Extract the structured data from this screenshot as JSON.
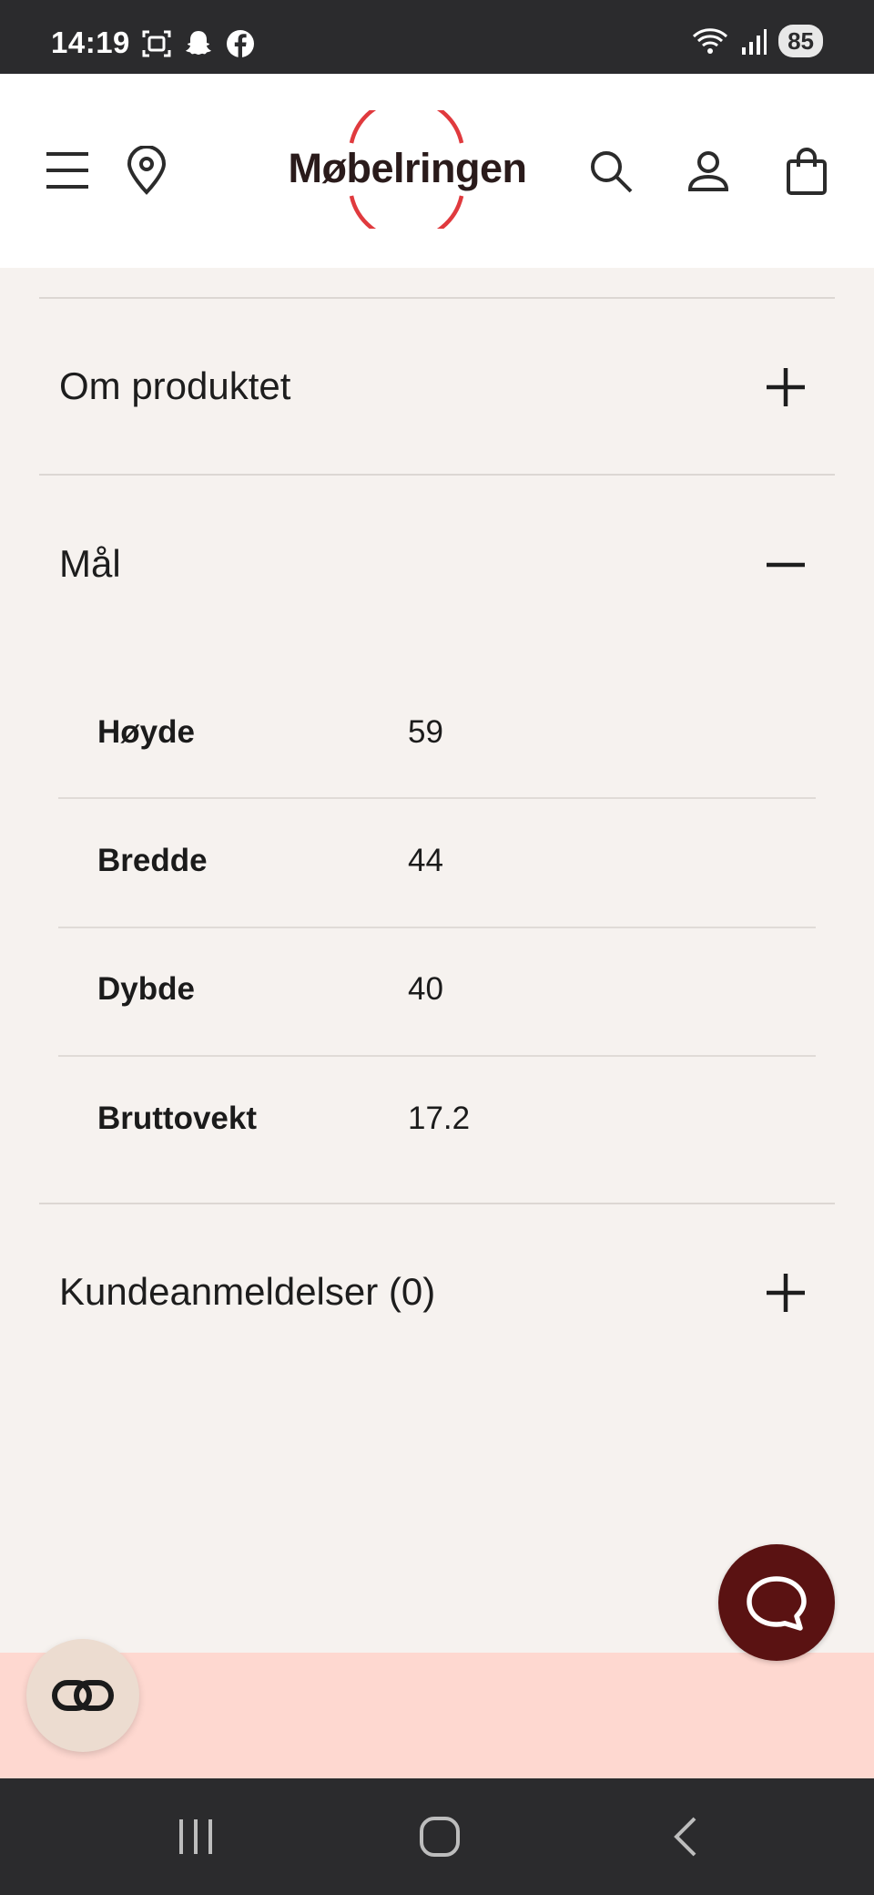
{
  "status_bar": {
    "time": "14:19",
    "left_icons": [
      "screenshot-icon",
      "snapchat-icon",
      "facebook-icon"
    ],
    "right_icons": [
      "wifi-icon",
      "signal-icon"
    ],
    "battery": "85"
  },
  "header": {
    "logo_text": "Møbelringen",
    "brand_color": "#e03a3e",
    "icons": [
      "menu-icon",
      "location-pin-icon",
      "search-icon",
      "user-icon",
      "shopping-bag-icon"
    ]
  },
  "accordion": {
    "about": {
      "title": "Om produktet",
      "state": "collapsed"
    },
    "dimensions": {
      "title": "Mål",
      "state": "expanded",
      "rows": [
        {
          "label": "Høyde",
          "value": "59"
        },
        {
          "label": "Bredde",
          "value": "44"
        },
        {
          "label": "Dybde",
          "value": "40"
        },
        {
          "label": "Bruttovekt",
          "value": "17.2"
        }
      ]
    },
    "reviews": {
      "title": "Kundeanmeldelser (0)",
      "state": "collapsed"
    }
  },
  "floating": {
    "chat_icon": "chat-bubble-icon",
    "chat_color": "#5a1212",
    "link_icon": "link-icon"
  },
  "banner": {
    "color": "#fed8d0"
  },
  "nav_bar": {
    "buttons": [
      "recent-apps-icon",
      "home-icon",
      "back-icon"
    ]
  }
}
